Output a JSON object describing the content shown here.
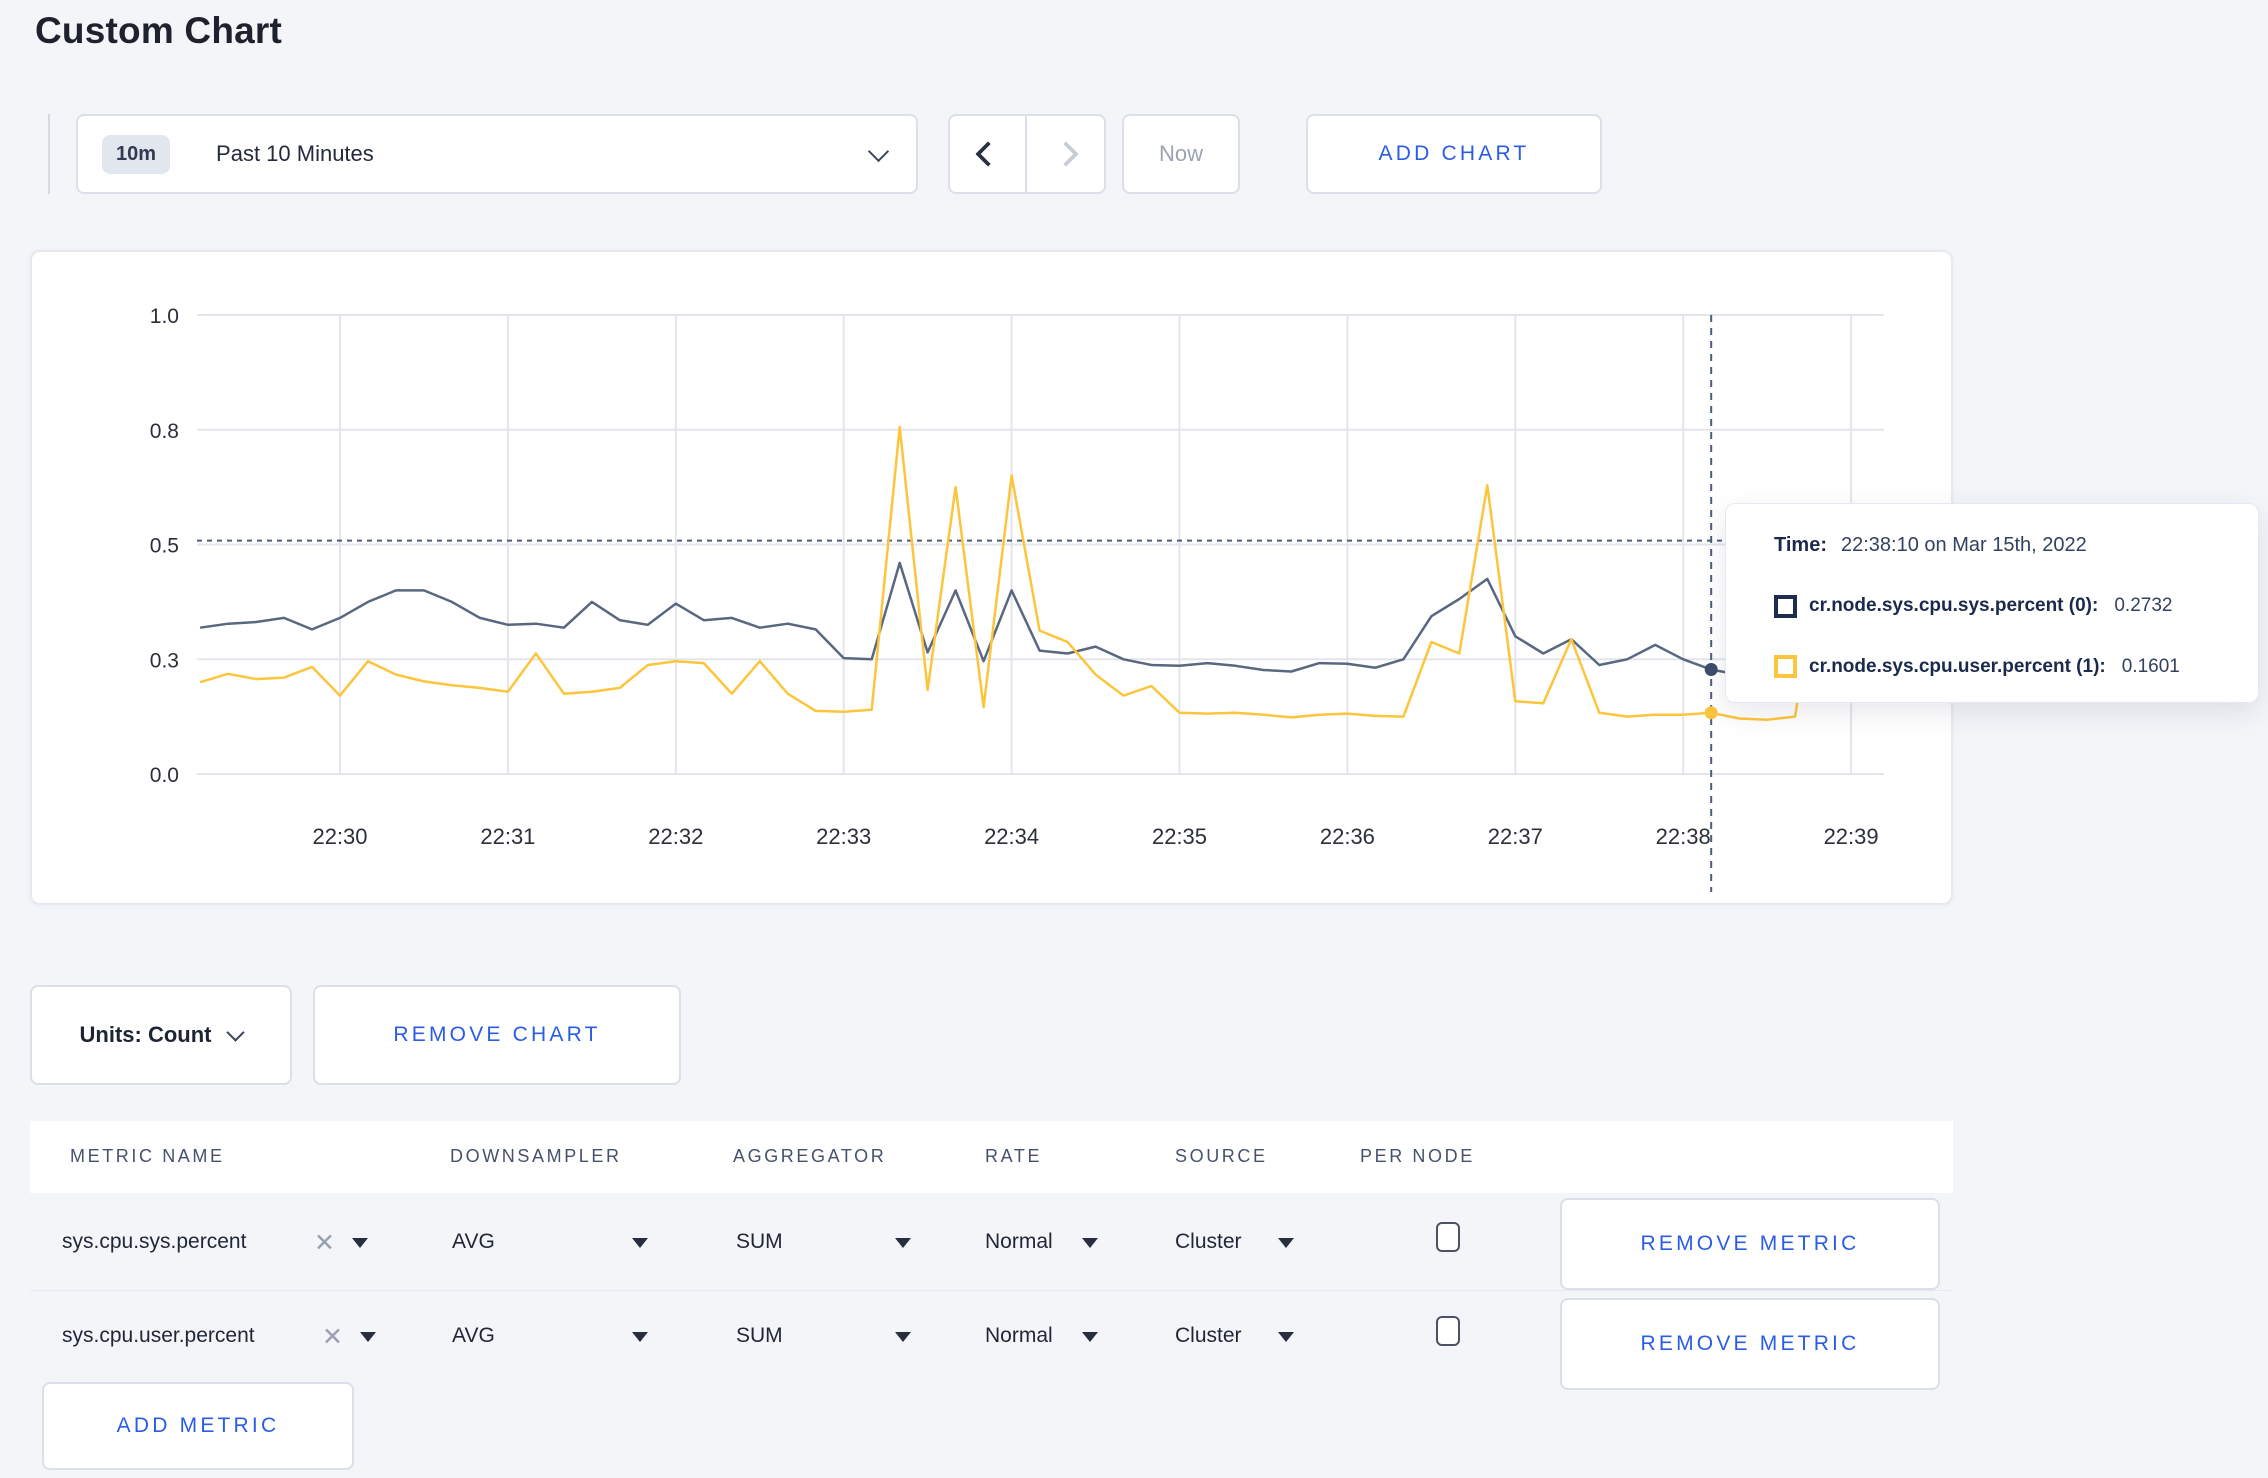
{
  "page_title": "Custom Chart",
  "toolbar": {
    "time_badge": "10m",
    "time_label": "Past 10 Minutes",
    "now_label": "Now",
    "add_chart_label": "ADD CHART"
  },
  "colors": {
    "series_sys": "#596780",
    "series_user": "#fdc53c",
    "legend_sys": "#1e2c4e",
    "legend_user": "#fdc53c",
    "accent_blue": "#2b5ce6",
    "grid": "#e3e5eb",
    "crosshair": "#4d5d7c",
    "page_bg": "#f4f5f9"
  },
  "chart_data": {
    "type": "line",
    "title": "",
    "xlabel": "",
    "ylabel": "",
    "grid": true,
    "y_tick_labels": [
      "0.0",
      "0.3",
      "0.5",
      "0.8",
      "1.0"
    ],
    "y_tick_values": [
      0.0,
      0.3,
      0.5,
      0.8,
      1.0
    ],
    "x_tick_labels": [
      "22:30",
      "22:31",
      "22:32",
      "22:33",
      "22:34",
      "22:35",
      "22:36",
      "22:37",
      "22:38",
      "22:39"
    ],
    "x_start_time": "22:29:10",
    "x_step_seconds": 10,
    "series": [
      {
        "name": "cr.node.sys.cpu.sys.percent",
        "color": "#596780",
        "values": [
          0.355,
          0.362,
          0.365,
          0.372,
          0.352,
          0.372,
          0.4,
          0.42,
          0.42,
          0.4,
          0.372,
          0.36,
          0.362,
          0.355,
          0.4,
          0.368,
          0.36,
          0.397,
          0.368,
          0.372,
          0.355,
          0.362,
          0.352,
          0.302,
          0.3,
          0.468,
          0.312,
          0.42,
          0.295,
          0.42,
          0.315,
          0.31,
          0.322,
          0.3,
          0.285,
          0.283,
          0.29,
          0.283,
          0.272,
          0.268,
          0.29,
          0.288,
          0.278,
          0.3,
          0.375,
          0.405,
          0.44,
          0.34,
          0.31,
          0.335,
          0.285,
          0.3,
          0.325,
          0.3,
          0.273,
          0.26,
          0.27,
          0.28,
          0.3,
          0.31,
          0.33
        ]
      },
      {
        "name": "cr.node.sys.cpu.user.percent",
        "color": "#fdc53c",
        "values": [
          0.24,
          0.262,
          0.248,
          0.252,
          0.28,
          0.205,
          0.295,
          0.26,
          0.242,
          0.232,
          0.225,
          0.215,
          0.31,
          0.21,
          0.215,
          0.225,
          0.285,
          0.295,
          0.29,
          0.21,
          0.295,
          0.21,
          0.165,
          0.163,
          0.168,
          0.805,
          0.22,
          0.65,
          0.175,
          0.68,
          0.35,
          0.33,
          0.26,
          0.205,
          0.23,
          0.16,
          0.158,
          0.16,
          0.155,
          0.148,
          0.155,
          0.158,
          0.152,
          0.15,
          0.33,
          0.31,
          0.655,
          0.19,
          0.185,
          0.335,
          0.16,
          0.15,
          0.155,
          0.155,
          0.1601,
          0.145,
          0.142,
          0.15,
          0.52,
          0.28,
          0.24
        ]
      }
    ],
    "hover": {
      "index": 54,
      "rule_value": 0.51,
      "dots": [
        {
          "series": 0,
          "value": 0.2732,
          "color": "#3d4c6b"
        },
        {
          "series": 1,
          "value": 0.1601,
          "color": "#fdc53c"
        }
      ]
    }
  },
  "tooltip": {
    "time_label": "Time:",
    "time_value": "22:38:10 on Mar 15th, 2022",
    "entries": [
      {
        "label": "cr.node.sys.cpu.sys.percent (0):",
        "value": "0.2732",
        "color": "#1e2c4e"
      },
      {
        "label": "cr.node.sys.cpu.user.percent (1):",
        "value": "0.1601",
        "color": "#fdc53c"
      }
    ]
  },
  "chart_footer": {
    "units_label": "Units: Count",
    "remove_chart_label": "REMOVE CHART"
  },
  "metrics_table": {
    "headers": [
      "METRIC NAME",
      "DOWNSAMPLER",
      "AGGREGATOR",
      "RATE",
      "SOURCE",
      "PER NODE"
    ],
    "rows": [
      {
        "metric": "sys.cpu.sys.percent",
        "downsampler": "AVG",
        "aggregator": "SUM",
        "rate": "Normal",
        "source": "Cluster",
        "per_node_checked": false,
        "remove_label": "REMOVE METRIC"
      },
      {
        "metric": "sys.cpu.user.percent",
        "downsampler": "AVG",
        "aggregator": "SUM",
        "rate": "Normal",
        "source": "Cluster",
        "per_node_checked": false,
        "remove_label": "REMOVE METRIC"
      }
    ],
    "add_metric_label": "ADD METRIC"
  }
}
